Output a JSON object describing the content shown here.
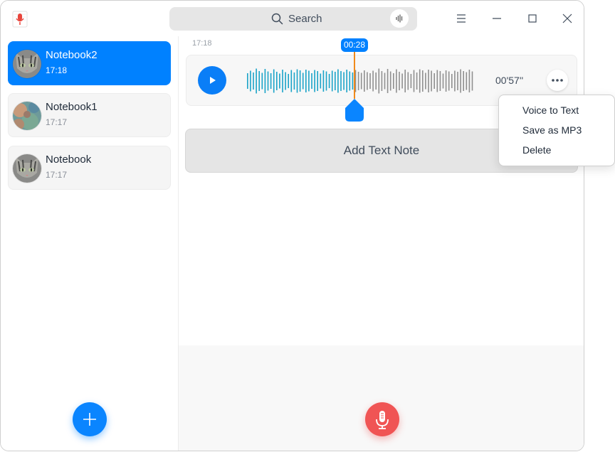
{
  "titlebar": {
    "search_placeholder": "Search"
  },
  "sidebar": {
    "notebooks": [
      {
        "title": "Notebook2",
        "time": "17:18",
        "active": true
      },
      {
        "title": "Notebook1",
        "time": "17:17",
        "active": false
      },
      {
        "title": "Notebook",
        "time": "17:17",
        "active": false
      }
    ]
  },
  "main": {
    "recording_time": "17:18",
    "voice_note": {
      "playhead_time": "00:28",
      "duration": "00'57''"
    },
    "add_text_note_label": "Add Text Note"
  },
  "context_menu": {
    "items": [
      "Voice to Text",
      "Save as MP3",
      "Delete"
    ]
  },
  "colors": {
    "accent": "#0081ff",
    "record": "#f05454",
    "playhead": "#f08a1c",
    "wave_played": "#1aa3c8",
    "wave_unplayed": "#8f8f8f"
  }
}
